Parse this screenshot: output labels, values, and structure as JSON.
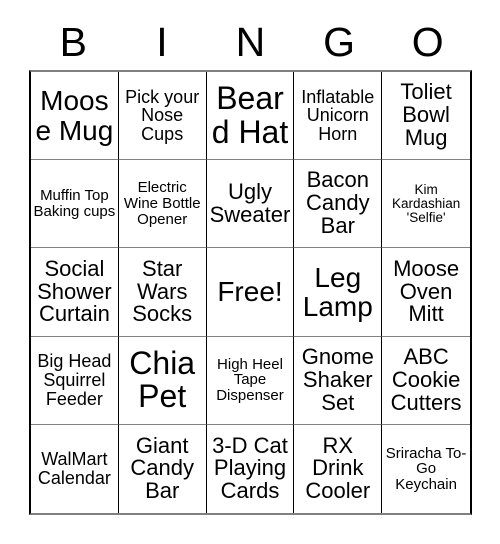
{
  "card": {
    "header_letters": [
      "B",
      "I",
      "N",
      "G",
      "O"
    ],
    "columns": 5,
    "rows": 5,
    "free_space_label": "Free!",
    "free_space_index": 12,
    "colors": {
      "background": "#ffffff",
      "text": "#000000",
      "vertical_border": "#000000",
      "horizontal_border": "#808080"
    },
    "cells": [
      {
        "label": "Moose Mug",
        "size": "lg"
      },
      {
        "label": "Pick your Nose Cups",
        "size": "sm"
      },
      {
        "label": "Beard Hat",
        "size": "xl"
      },
      {
        "label": "Inflatable Unicorn Horn",
        "size": "sm"
      },
      {
        "label": "Toliet Bowl Mug",
        "size": "md"
      },
      {
        "label": "Muffin Top Baking cups",
        "size": "xs"
      },
      {
        "label": "Electric Wine Bottle Opener",
        "size": "xs"
      },
      {
        "label": "Ugly Sweater",
        "size": "md"
      },
      {
        "label": "Bacon Candy Bar",
        "size": "md"
      },
      {
        "label": "Kim Kardashian 'Selfie'",
        "size": "xxs"
      },
      {
        "label": "Social Shower Curtain",
        "size": "md"
      },
      {
        "label": "Star Wars Socks",
        "size": "md"
      },
      {
        "label": "Free!",
        "size": "lg"
      },
      {
        "label": "Leg Lamp",
        "size": "lg"
      },
      {
        "label": "Moose Oven Mitt",
        "size": "md"
      },
      {
        "label": "Big Head Squirrel Feeder",
        "size": "sm"
      },
      {
        "label": "Chia Pet",
        "size": "xl"
      },
      {
        "label": "High Heel Tape Dispenser",
        "size": "xs"
      },
      {
        "label": "Gnome Shaker Set",
        "size": "md"
      },
      {
        "label": "ABC Cookie Cutters",
        "size": "md"
      },
      {
        "label": "WalMart Calendar",
        "size": "sm"
      },
      {
        "label": "Giant Candy Bar",
        "size": "md"
      },
      {
        "label": "3-D Cat Playing Cards",
        "size": "md"
      },
      {
        "label": "RX Drink Cooler",
        "size": "md"
      },
      {
        "label": "Sriracha To-Go Keychain",
        "size": "xs"
      }
    ]
  }
}
